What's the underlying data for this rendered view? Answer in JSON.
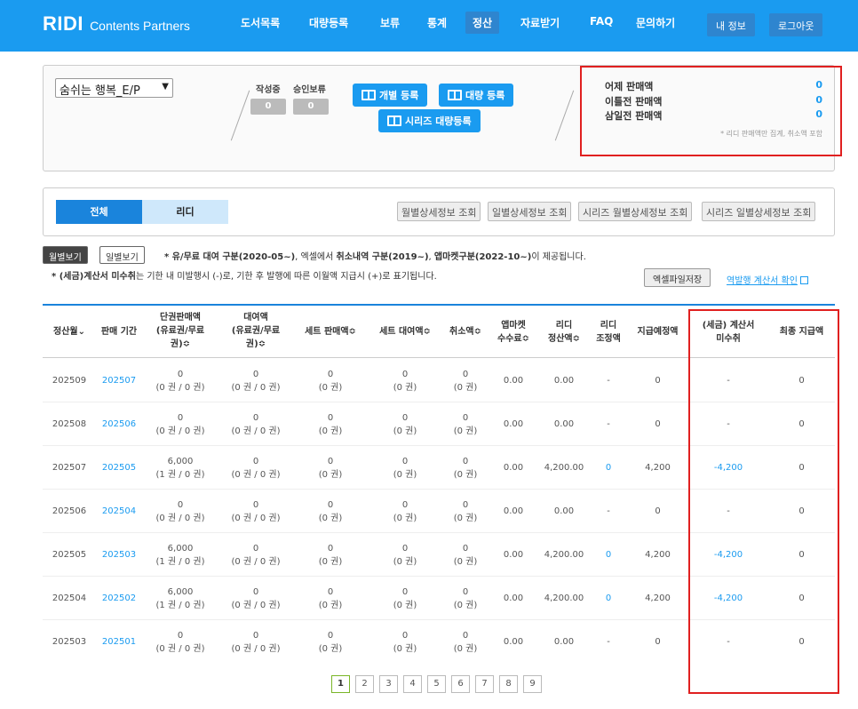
{
  "nav": {
    "logo_brand": "RIDI",
    "logo_sub": "Contents Partners",
    "items": [
      "도서목록",
      "대량등록",
      "보류",
      "통계",
      "정산",
      "자료받기",
      "FAQ",
      "문의하기"
    ],
    "my_info": "내 정보",
    "logout": "로그아웃"
  },
  "summary": {
    "book_select": "숨쉬는 행복_E/P",
    "writing_label": "작성중",
    "writing_value": "0",
    "pending_label": "승인보류",
    "pending_value": "0",
    "individual_register": "개별 등록",
    "bulk_register": "대량 등록",
    "series_bulk_register": "시리즈 대량등록",
    "sales": [
      {
        "label": "어제 판매액",
        "value": "0"
      },
      {
        "label": "이틀전 판매액",
        "value": "0"
      },
      {
        "label": "삼일전 판매액",
        "value": "0"
      }
    ],
    "sales_note": "* 리디 판매액만 집계, 취소액 포함"
  },
  "filter": {
    "tab_all": "전체",
    "tab_ridi": "리디",
    "buttons": [
      "월별상세정보 조회",
      "일별상세정보 조회",
      "시리즈 월별상세정보 조회",
      "시리즈 일별상세정보 조회"
    ]
  },
  "view": {
    "monthly": "월별보기",
    "daily": "일별보기",
    "note1_a": "* 유/무료 대여 구분(2020-05~)",
    "note1_b": ", 엑셀에서 ",
    "note1_c": "취소내역 구분(2019~)",
    "note1_d": ", ",
    "note1_e": "앱마켓구분(2022-10~)",
    "note1_f": "이 제공됩니다.",
    "note2_a": "* (세금)계산서 미수취",
    "note2_b": "는 기한 내 미발행시 (-)로, 기한 후 발행에 따른 이월액 지급시 (+)로 표기됩니다.",
    "excel_save": "엑셀파일저장",
    "reverse_invoice": "역발행 계산서 확인"
  },
  "table": {
    "headers": [
      "정산월⌄",
      "판매 기간",
      "단권판매액\n(유료권/무료\n권)≎",
      "대여액\n(유료권/무료\n권)≎",
      "세트 판매액≎",
      "세트 대여액≎",
      "취소액≎",
      "앱마켓\n수수료≎",
      "리디\n정산액≎",
      "리디\n조정액",
      "지급예정액",
      "(세금) 계산서\n미수취",
      "최종 지급액"
    ],
    "rows": [
      [
        "202509",
        "202507",
        "0\n(0 권 / 0 권)",
        "0\n(0 권 / 0 권)",
        "0\n(0 권)",
        "0\n(0 권)",
        "0\n(0 권)",
        "0.00",
        "0.00",
        "-",
        "0",
        "-",
        "0"
      ],
      [
        "202508",
        "202506",
        "0\n(0 권 / 0 권)",
        "0\n(0 권 / 0 권)",
        "0\n(0 권)",
        "0\n(0 권)",
        "0\n(0 권)",
        "0.00",
        "0.00",
        "-",
        "0",
        "-",
        "0"
      ],
      [
        "202507",
        "202505",
        "6,000\n(1 권 / 0 권)",
        "0\n(0 권 / 0 권)",
        "0\n(0 권)",
        "0\n(0 권)",
        "0\n(0 권)",
        "0.00",
        "4,200.00",
        "0",
        "4,200",
        "-4,200",
        "0"
      ],
      [
        "202506",
        "202504",
        "0\n(0 권 / 0 권)",
        "0\n(0 권 / 0 권)",
        "0\n(0 권)",
        "0\n(0 권)",
        "0\n(0 권)",
        "0.00",
        "0.00",
        "-",
        "0",
        "-",
        "0"
      ],
      [
        "202505",
        "202503",
        "6,000\n(1 권 / 0 권)",
        "0\n(0 권 / 0 권)",
        "0\n(0 권)",
        "0\n(0 권)",
        "0\n(0 권)",
        "0.00",
        "4,200.00",
        "0",
        "4,200",
        "-4,200",
        "0"
      ],
      [
        "202504",
        "202502",
        "6,000\n(1 권 / 0 권)",
        "0\n(0 권 / 0 권)",
        "0\n(0 권)",
        "0\n(0 권)",
        "0\n(0 권)",
        "0.00",
        "4,200.00",
        "0",
        "4,200",
        "-4,200",
        "0"
      ],
      [
        "202503",
        "202501",
        "0\n(0 권 / 0 권)",
        "0\n(0 권 / 0 권)",
        "0\n(0 권)",
        "0\n(0 권)",
        "0\n(0 권)",
        "0.00",
        "0.00",
        "-",
        "0",
        "-",
        "0"
      ]
    ]
  },
  "pagination": [
    "1",
    "2",
    "3",
    "4",
    "5",
    "6",
    "7",
    "8",
    "9"
  ],
  "colors": {
    "brand": "#1a9bf0",
    "highlight_box": "#e02020"
  }
}
